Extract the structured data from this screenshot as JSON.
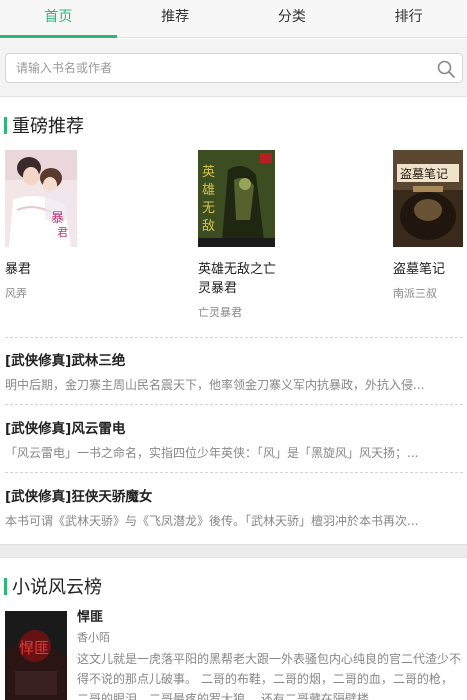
{
  "tabs": [
    {
      "label": "首页",
      "active": true
    },
    {
      "label": "推荐",
      "active": false
    },
    {
      "label": "分类",
      "active": false
    },
    {
      "label": "排行",
      "active": false
    }
  ],
  "search": {
    "placeholder": "请输入书名或作者"
  },
  "featured": {
    "title": "重磅推荐",
    "books": [
      {
        "title": "暴君",
        "author": "风弄"
      },
      {
        "title": "英雄无敌之亡灵暴君",
        "author": "亡灵暴君"
      },
      {
        "title": "盗墓笔记",
        "author": "南派三叔"
      }
    ],
    "list": [
      {
        "title": "[武侠修真]武林三绝",
        "desc": "明中后期，金刀寨主周山民名震天下，他率领金刀寨义军内抗暴政，外抗入侵..."
      },
      {
        "title": "[武侠修真]风云雷电",
        "desc": "「风云雷电」一书之命名，实指四位少年英侠：「风」是「黑旋风」风天扬；..."
      },
      {
        "title": "[武侠修真]狂侠天骄魔女",
        "desc": "本书可谓《武林天骄》与《飞凤潜龙》後传。「武林天骄」檀羽冲於本书再次..."
      }
    ]
  },
  "ranking": {
    "title": "小说风云榜",
    "items": [
      {
        "title": "悍匪",
        "author": "香小陌",
        "desc": "这文儿就是一虎落平阳的黑帮老大跟一外表骚包内心纯良的官二代渣少不得不说的那点儿破事。 二哥的布鞋，二哥的烟，二哥的血，二哥的枪，二哥的眼泪，二哥最疼的罗大狼， 还有二哥藏在隔壁楼"
      }
    ]
  },
  "colors": {
    "accent": "#2bb873"
  }
}
